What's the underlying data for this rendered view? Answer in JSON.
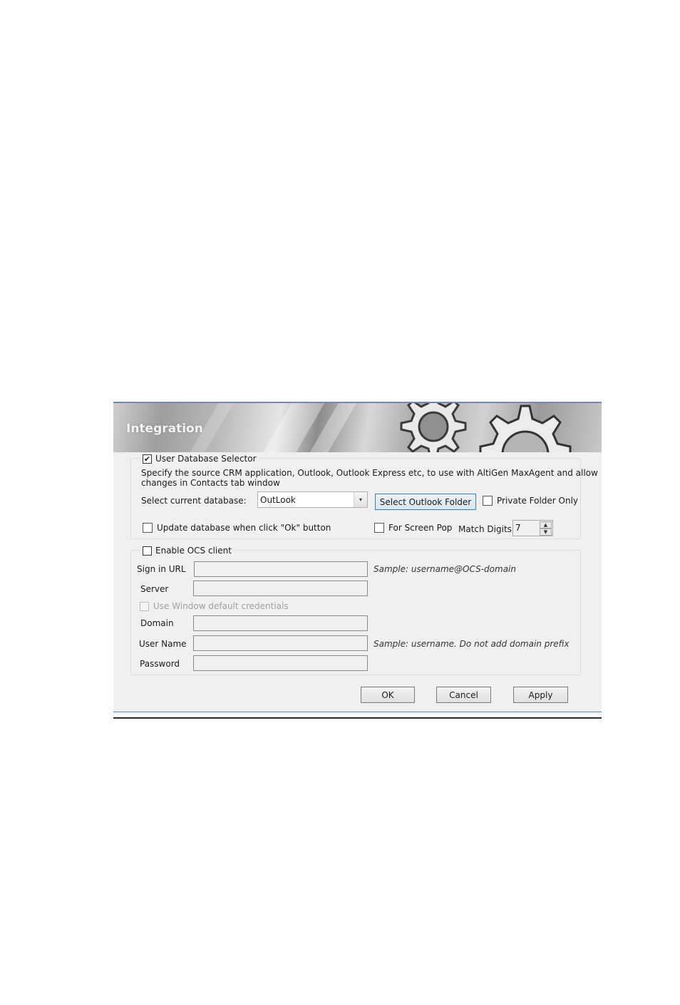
{
  "dialog": {
    "title": "Integration"
  },
  "user_database": {
    "legend_label": "User Database Selector",
    "legend_checked": true,
    "description_line1": "Specify the source CRM application, Outlook, Outlook Express etc, to use with AltiGen MaxAgent and allow",
    "description_line2": "changes in Contacts tab window",
    "select_label": "Select current database:",
    "select_value": "OutLook",
    "select_outlook_folder_label": "Select Outlook Folder",
    "private_folder_label": "Private Folder Only",
    "private_folder_checked": false,
    "update_db_label": "Update database when click \"Ok\" button",
    "update_db_checked": false,
    "screen_pop_label": "For Screen Pop",
    "screen_pop_checked": false,
    "match_digits_label": "Match Digits",
    "match_digits_value": "7"
  },
  "ocs": {
    "legend_label": "Enable OCS client",
    "legend_checked": false,
    "sign_in_url_label": "Sign in URL",
    "sign_in_url_value": "",
    "sign_in_url_hint": "Sample: username@OCS-domain",
    "server_label": "Server",
    "server_value": "",
    "use_default_creds_label": "Use Window default credentials",
    "use_default_creds_checked": false,
    "domain_label": "Domain",
    "domain_value": "",
    "username_label": "User Name",
    "username_value": "",
    "username_hint": "Sample: username. Do not add domain prefix",
    "password_label": "Password",
    "password_value": ""
  },
  "buttons": {
    "ok": "OK",
    "cancel": "Cancel",
    "apply": "Apply"
  },
  "icons": {
    "checked_glyph": "✔",
    "dropdown_glyph": "▾",
    "spin_up_glyph": "▲",
    "spin_down_glyph": "▼"
  }
}
